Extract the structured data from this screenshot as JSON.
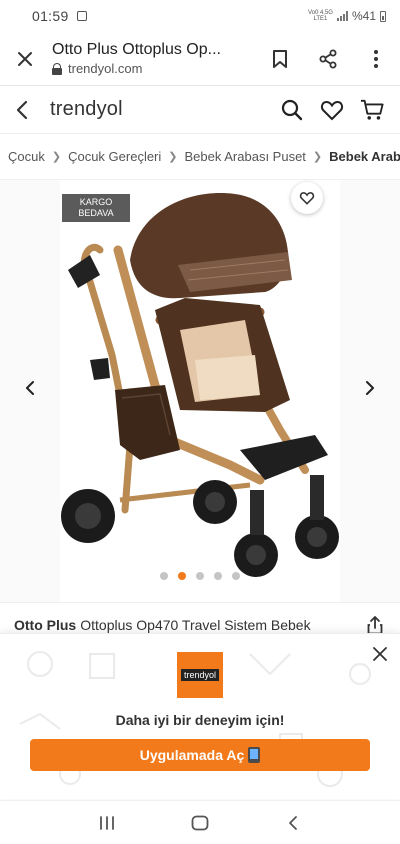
{
  "status_bar": {
    "time": "01:59",
    "network_line1": "Vo0 4,5G",
    "network_line2": "LTE1",
    "battery": "%41"
  },
  "browser": {
    "title": "Otto Plus Ottoplus Op...",
    "url": "trendyol.com",
    "icons": [
      "close-icon",
      "lock-icon",
      "bookmark-icon",
      "share-icon",
      "more-vertical-icon"
    ]
  },
  "header": {
    "logo": "trendyol",
    "icons": [
      "back-arrow-icon",
      "search-icon",
      "heart-icon",
      "cart-icon"
    ]
  },
  "breadcrumb": [
    {
      "label": "Çocuk"
    },
    {
      "label": "Çocuk Gereçleri"
    },
    {
      "label": "Bebek Arabası Puset"
    },
    {
      "label": "Bebek Arabası"
    }
  ],
  "gallery": {
    "badge_line1": "KARGO",
    "badge_line2": "BEDAVA",
    "image_count": 5,
    "active_image_index": 1,
    "accent_color": "#f27a1a"
  },
  "product": {
    "brand": "Otto Plus",
    "name": "Ottoplus Op470 Travel Sistem Bebek"
  },
  "app_banner": {
    "logo_text": "trendyol",
    "tagline": "Daha iyi bir deneyim için!",
    "cta_label": "Uygulamada Aç",
    "cta_color": "#f27a1a"
  },
  "nav_bar": {
    "icons": [
      "recent-apps-icon",
      "home-icon",
      "back-icon"
    ]
  }
}
